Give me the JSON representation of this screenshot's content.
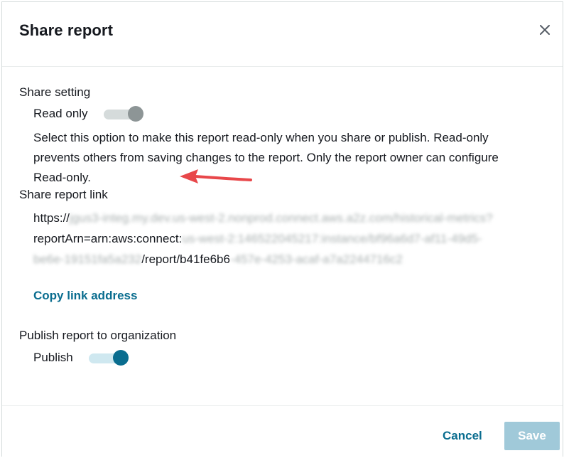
{
  "dialog": {
    "title": "Share report",
    "close_icon": "close-icon"
  },
  "share_setting": {
    "label": "Share setting",
    "toggle_label": "Read only",
    "toggle_state": "off",
    "description_lines": [
      "Select this option to make this report read-only when you share or publish. Read-only",
      "prevents others from saving changes to the report. Only the report owner can configure",
      "Read-only."
    ]
  },
  "share_link": {
    "label": "Share report link",
    "line1_prefix": "https://",
    "line1_blurred": "jgus3-integ.my.dev.us-west-2.nonprod.connect.aws.a2z.com/historical-metrics?",
    "line2_prefix": "reportArn=arn:aws:connect:",
    "line2_blurred": "us-west-2:146522045217:instance/bf96a6d7-af11-49d5-",
    "line3_blurred": "be6e-19151fa5a232",
    "line3_middle": "/report/b41fe6b6",
    "line3_blurred_tail": "-457e-4253-acaf-a7a2244716c2",
    "copy_link_label": "Copy link address"
  },
  "publish": {
    "label": "Publish report to organization",
    "toggle_label": "Publish",
    "toggle_state": "on"
  },
  "footer": {
    "cancel_label": "Cancel",
    "save_label": "Save",
    "save_enabled": false
  },
  "annotation": {
    "arrow_color": "#e8474a",
    "arrow_target": "read-only-toggle"
  },
  "colors": {
    "accent": "#0a6d8f",
    "toggle_off": "#8d9596",
    "save_disabled": "#a0c9d9"
  }
}
